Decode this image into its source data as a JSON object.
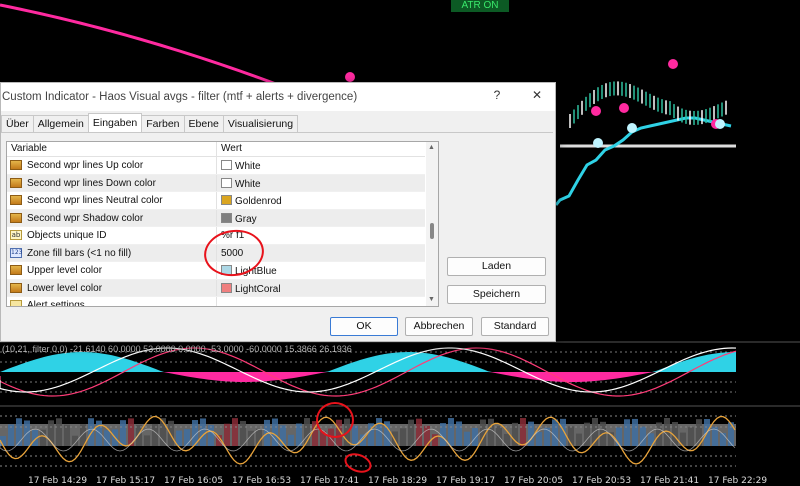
{
  "chart": {
    "badge": "ATR ON",
    "indicator_info": "(10,21, filter 0,0) -21.6140 60.0000 53.0000 0.0000 -53.0000 -60.0000 15.3866 26.1936",
    "time_labels": [
      "17 Feb 14:29",
      "17 Feb 15:17",
      "17 Feb 16:05",
      "17 Feb 16:53",
      "17 Feb 17:41",
      "17 Feb 18:29",
      "17 Feb 19:17",
      "17 Feb 20:05",
      "17 Feb 20:53",
      "17 Feb 21:41",
      "17 Feb 22:29"
    ],
    "colors": {
      "cyan": "#2fd2e6",
      "magenta": "#ff2aa0",
      "orange": "#e8a33a",
      "white": "#ffffff",
      "green": "#2f8c6a"
    }
  },
  "dialog": {
    "title": "Custom Indicator - Haos Visual avgs - filter (mtf + alerts + divergence)",
    "help_label": "?",
    "close_label": "✕",
    "tabs": [
      "Über",
      "Allgemein",
      "Eingaben",
      "Farben",
      "Ebene",
      "Visualisierung"
    ],
    "active_tab": "Eingaben",
    "columns": {
      "variable": "Variable",
      "value": "Wert"
    },
    "rows": [
      {
        "name": "Second wpr lines Up color",
        "value": "White",
        "icon": "color",
        "swatch": "#ffffff"
      },
      {
        "name": "Second wpr lines Down color",
        "value": "White",
        "icon": "color",
        "swatch": "#ffffff"
      },
      {
        "name": "Second wpr lines Neutral color",
        "value": "Goldenrod",
        "icon": "color",
        "swatch": "#daa520"
      },
      {
        "name": "Second wpr Shadow color",
        "value": "Gray",
        "icon": "color",
        "swatch": "#808080"
      },
      {
        "name": "Objects unique ID",
        "value": "%r f1",
        "icon": "text"
      },
      {
        "name": "Zone fill bars (<1 no fill)",
        "value": "5000",
        "icon": "num"
      },
      {
        "name": "Upper level color",
        "value": "LightBlue",
        "icon": "color",
        "swatch": "#add8e6"
      },
      {
        "name": "Lower level color",
        "value": "LightCoral",
        "icon": "color",
        "swatch": "#f08080"
      },
      {
        "name": "Alert settings",
        "value": "",
        "icon": "bell"
      }
    ],
    "buttons": {
      "load": "Laden",
      "save": "Speichern",
      "ok": "OK",
      "cancel": "Abbrechen",
      "default": "Standard"
    }
  }
}
